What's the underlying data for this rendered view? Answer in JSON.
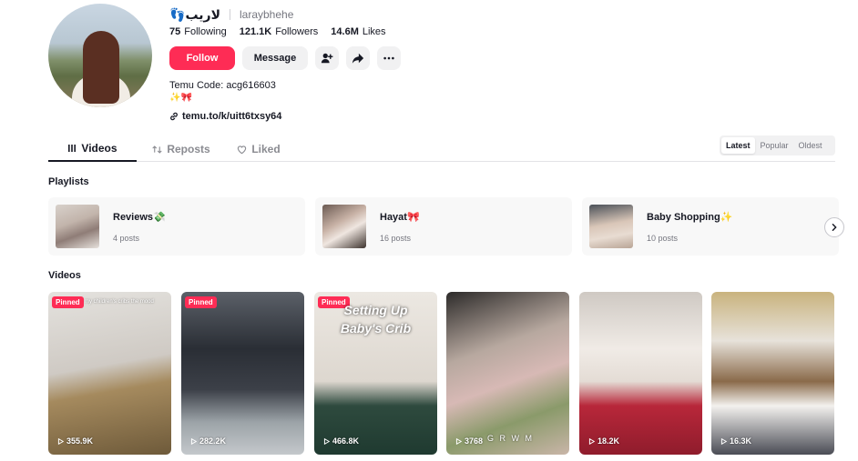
{
  "profile": {
    "display_name": "👣لاریب",
    "username": "laraybhehe",
    "stats": {
      "following_count": "75",
      "following_label": "Following",
      "followers_count": "121.1K",
      "followers_label": "Followers",
      "likes_count": "14.6M",
      "likes_label": "Likes"
    },
    "buttons": {
      "follow": "Follow",
      "message": "Message"
    },
    "bio_line1": "Temu Code: acg616603",
    "bio_line2": "✨🎀",
    "link": "temu.to/k/uitt6txsy64"
  },
  "tabs": [
    {
      "label": "Videos",
      "icon": "grid-icon",
      "active": true
    },
    {
      "label": "Reposts",
      "icon": "repost-icon",
      "active": false
    },
    {
      "label": "Liked",
      "icon": "heart-icon",
      "active": false
    }
  ],
  "sort": [
    "Latest",
    "Popular",
    "Oldest"
  ],
  "sort_active": "Latest",
  "playlists_title": "Playlists",
  "playlists": [
    {
      "title": "Reviews💸",
      "count": "4 posts"
    },
    {
      "title": "Hayat🎀",
      "count": "16 posts"
    },
    {
      "title": "Baby Shopping✨",
      "count": "10 posts"
    }
  ],
  "videos_title": "Videos",
  "videos": [
    {
      "views": "355.9K",
      "pinned": true,
      "badge": "Pinned",
      "overlay": "my children's cribs\nthe mood",
      "caption": ""
    },
    {
      "views": "282.2K",
      "pinned": true,
      "badge": "Pinned",
      "overlay": "",
      "caption": ""
    },
    {
      "views": "466.8K",
      "pinned": true,
      "badge": "Pinned",
      "overlay": "",
      "caption": "Setting Up\nBaby's Crib"
    },
    {
      "views": "3768",
      "pinned": false,
      "badge": "",
      "overlay": "G R W M",
      "caption": ""
    },
    {
      "views": "18.2K",
      "pinned": false,
      "badge": "",
      "overlay": "",
      "caption": ""
    },
    {
      "views": "16.3K",
      "pinned": false,
      "badge": "",
      "overlay": "",
      "caption": ""
    }
  ],
  "colors": {
    "accent": "#fe2c55",
    "text": "#161823",
    "muted": "#75767f",
    "surface": "#f1f1f2"
  }
}
